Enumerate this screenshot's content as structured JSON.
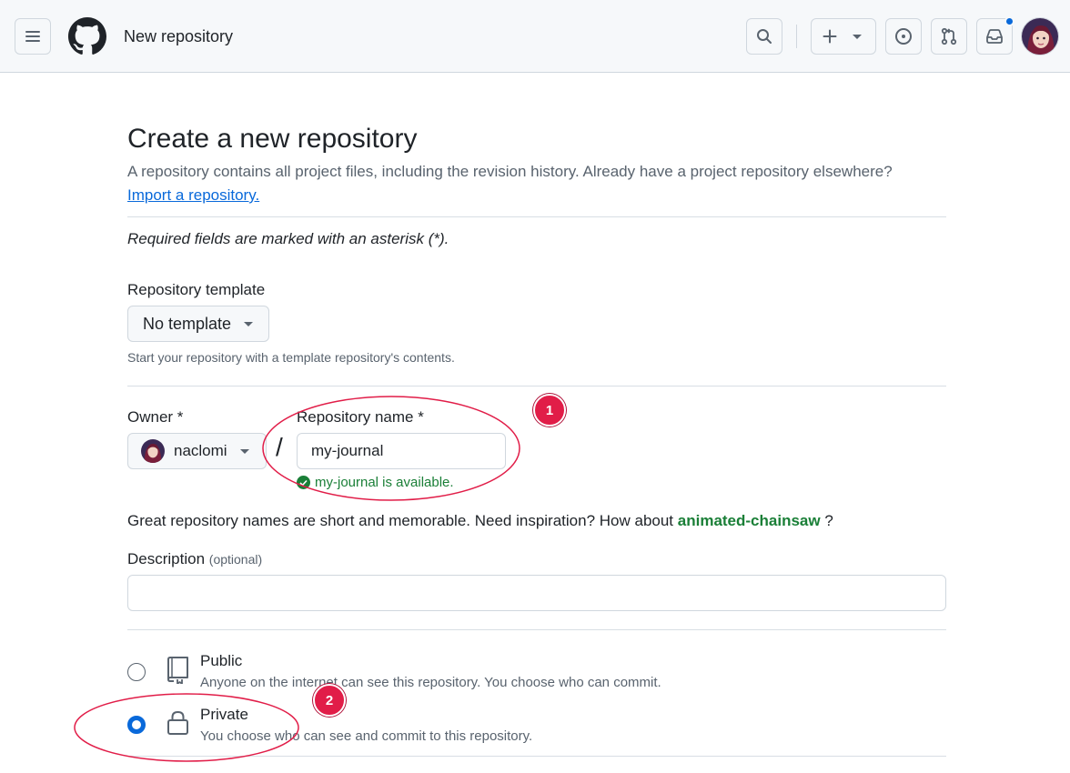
{
  "header": {
    "title": "New repository",
    "icons": [
      "menu-icon",
      "github-logo",
      "search-icon",
      "plus-icon",
      "issues-icon",
      "pull-requests-icon",
      "inbox-icon"
    ]
  },
  "page": {
    "heading": "Create a new repository",
    "lead": "A repository contains all project files, including the revision history. Already have a project repository elsewhere?",
    "import_link": "Import a repository.",
    "required_note": "Required fields are marked with an asterisk (*)."
  },
  "template": {
    "label": "Repository template",
    "value": "No template",
    "help": "Start your repository with a template repository's contents."
  },
  "owner": {
    "label": "Owner *",
    "value": "naclomi"
  },
  "repo_name": {
    "label": "Repository name *",
    "value": "my-journal",
    "separator": "/",
    "availability": "my-journal is available."
  },
  "inspiration": {
    "text": "Great repository names are short and memorable. Need inspiration? How about",
    "suggestion": "animated-chainsaw",
    "suffix": "?"
  },
  "description": {
    "label": "Description",
    "optional": "(optional)",
    "value": ""
  },
  "visibility": {
    "selected": "Private",
    "options": [
      {
        "title": "Public",
        "desc": "Anyone on the internet can see this repository. You choose who can commit."
      },
      {
        "title": "Private",
        "desc": "You choose who can see and commit to this repository."
      }
    ]
  },
  "annotations": [
    {
      "label": "1"
    },
    {
      "label": "2"
    }
  ],
  "colors": {
    "accent": "#0969da",
    "success": "#1a7f37",
    "annotation": "#e11d48"
  }
}
